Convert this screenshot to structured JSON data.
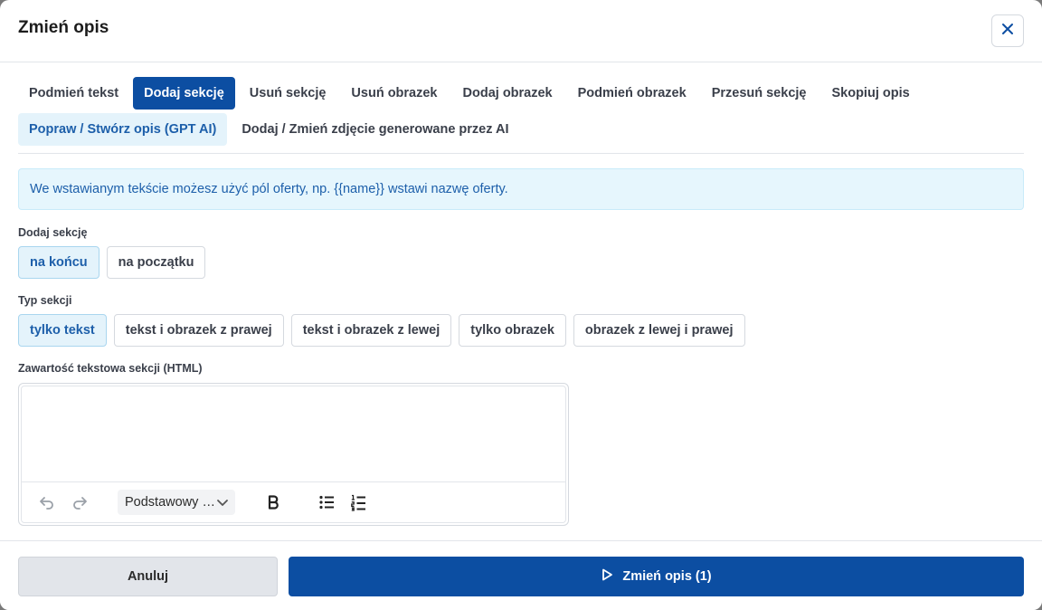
{
  "dialog": {
    "title": "Zmień opis",
    "close_icon": "close-icon"
  },
  "tabs": {
    "row1": [
      {
        "label": "Podmień tekst",
        "active": false
      },
      {
        "label": "Dodaj sekcję",
        "active": true
      },
      {
        "label": "Usuń sekcję",
        "active": false
      },
      {
        "label": "Usuń obrazek",
        "active": false
      },
      {
        "label": "Dodaj obrazek",
        "active": false
      },
      {
        "label": "Podmień obrazek",
        "active": false
      },
      {
        "label": "Przesuń sekcję",
        "active": false
      },
      {
        "label": "Skopiuj opis",
        "active": false
      }
    ],
    "row2": [
      {
        "label": "Popraw / Stwórz opis (GPT AI)",
        "highlighted": true
      },
      {
        "label": "Dodaj / Zmień zdjęcie generowane przez AI",
        "highlighted": false
      }
    ]
  },
  "info": {
    "text": "We wstawianym tekście możesz użyć pól oferty, np. {{name}} wstawi nazwę oferty."
  },
  "add_section": {
    "label": "Dodaj sekcję",
    "options": [
      "na końcu",
      "na początku"
    ],
    "selected": "na końcu"
  },
  "section_type": {
    "label": "Typ sekcji",
    "options": [
      "tylko tekst",
      "tekst i obrazek z prawej",
      "tekst i obrazek z lewej",
      "tylko obrazek",
      "obrazek z lewej i prawej"
    ],
    "selected": "tylko tekst"
  },
  "content": {
    "label": "Zawartość tekstowa sekcji (HTML)",
    "value": "",
    "toolbar": {
      "undo_icon": "undo-icon",
      "redo_icon": "redo-icon",
      "block_style": "Podstawowy tekst",
      "bold_icon": "bold-icon",
      "bullet_list_icon": "bullet-list-icon",
      "numbered_list_icon": "numbered-list-icon"
    }
  },
  "footer": {
    "cancel_label": "Anuluj",
    "submit_label": "Zmień opis (1)",
    "submit_icon": "play-icon"
  },
  "colors": {
    "primary": "#0c4ea2",
    "info_bg": "#e6f6fd",
    "selected_bg": "#e4f3fb",
    "text_accent": "#1d5faa"
  }
}
